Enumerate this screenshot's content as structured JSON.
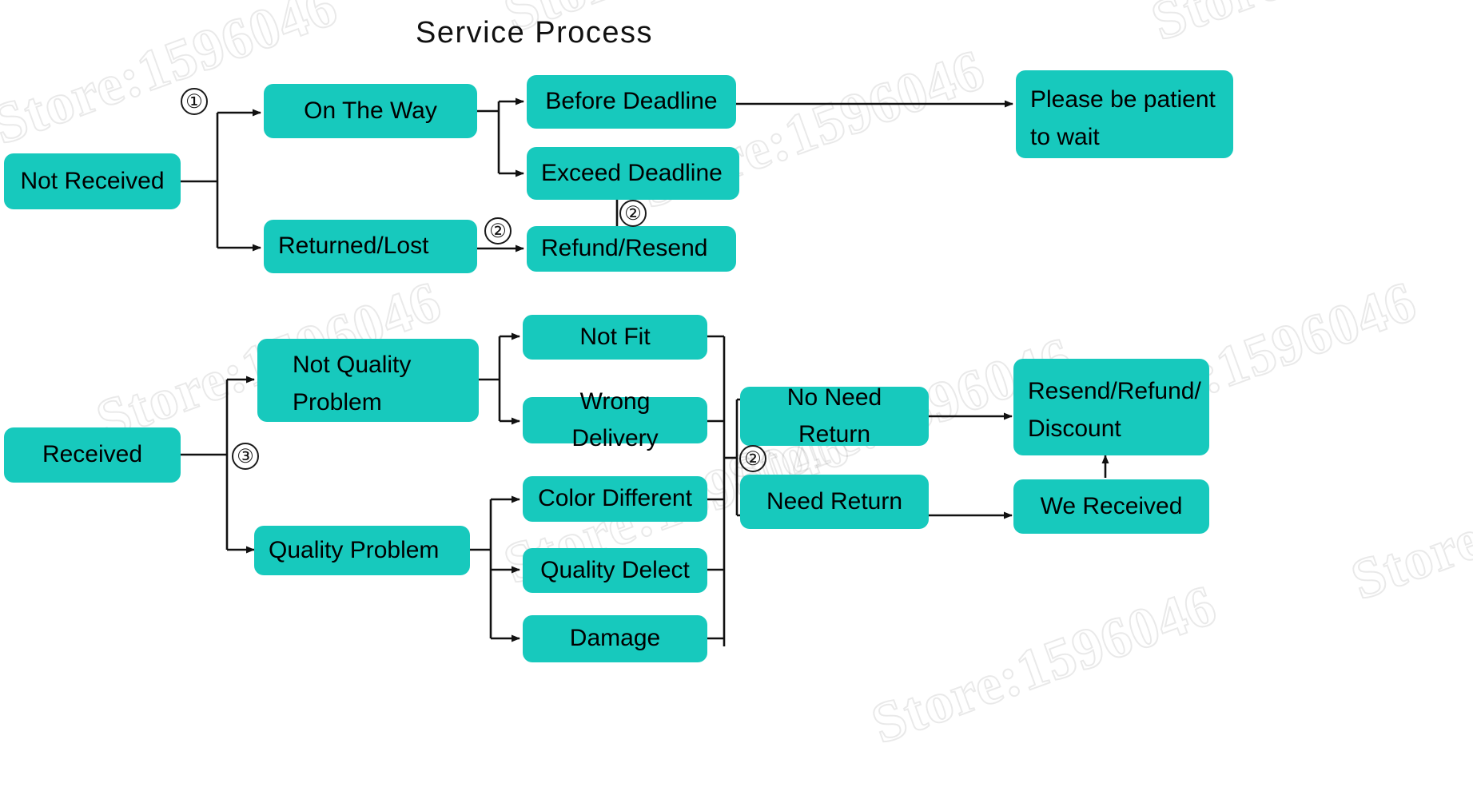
{
  "title": "Service Process",
  "colors": {
    "node_fill": "#17c9bd",
    "text": "#000000",
    "line": "#111111",
    "background": "#ffffff"
  },
  "watermark": {
    "text": "Store:1596046",
    "instances": 9
  },
  "markers": [
    {
      "id": "m1",
      "label": "①"
    },
    {
      "id": "m2a",
      "label": "②"
    },
    {
      "id": "m2b",
      "label": "②"
    },
    {
      "id": "m3",
      "label": "③"
    },
    {
      "id": "m2c",
      "label": "②"
    }
  ],
  "flow_top": {
    "root": "Not Received",
    "nodes": [
      "On The Way",
      "Returned/Lost",
      "Before Deadline",
      "Exceed Deadline",
      "Refund/Resend",
      "Please be patient"
    ],
    "please_line1": "Please be patient",
    "please_line2": "to wait"
  },
  "flow_bottom": {
    "root": "Received",
    "branch_a_line1": "Not Quality",
    "branch_a_line2": "Problem",
    "branch_b": "Quality Problem",
    "reasons": [
      "Not Fit",
      "Wrong Delivery",
      "Color Different",
      "Quality Delect",
      "Damage"
    ],
    "return_options": [
      "No Need Return",
      "Need Return"
    ],
    "outcome_line1": "Resend/Refund/",
    "outcome_line2": "Discount",
    "we_received": "We Received"
  }
}
